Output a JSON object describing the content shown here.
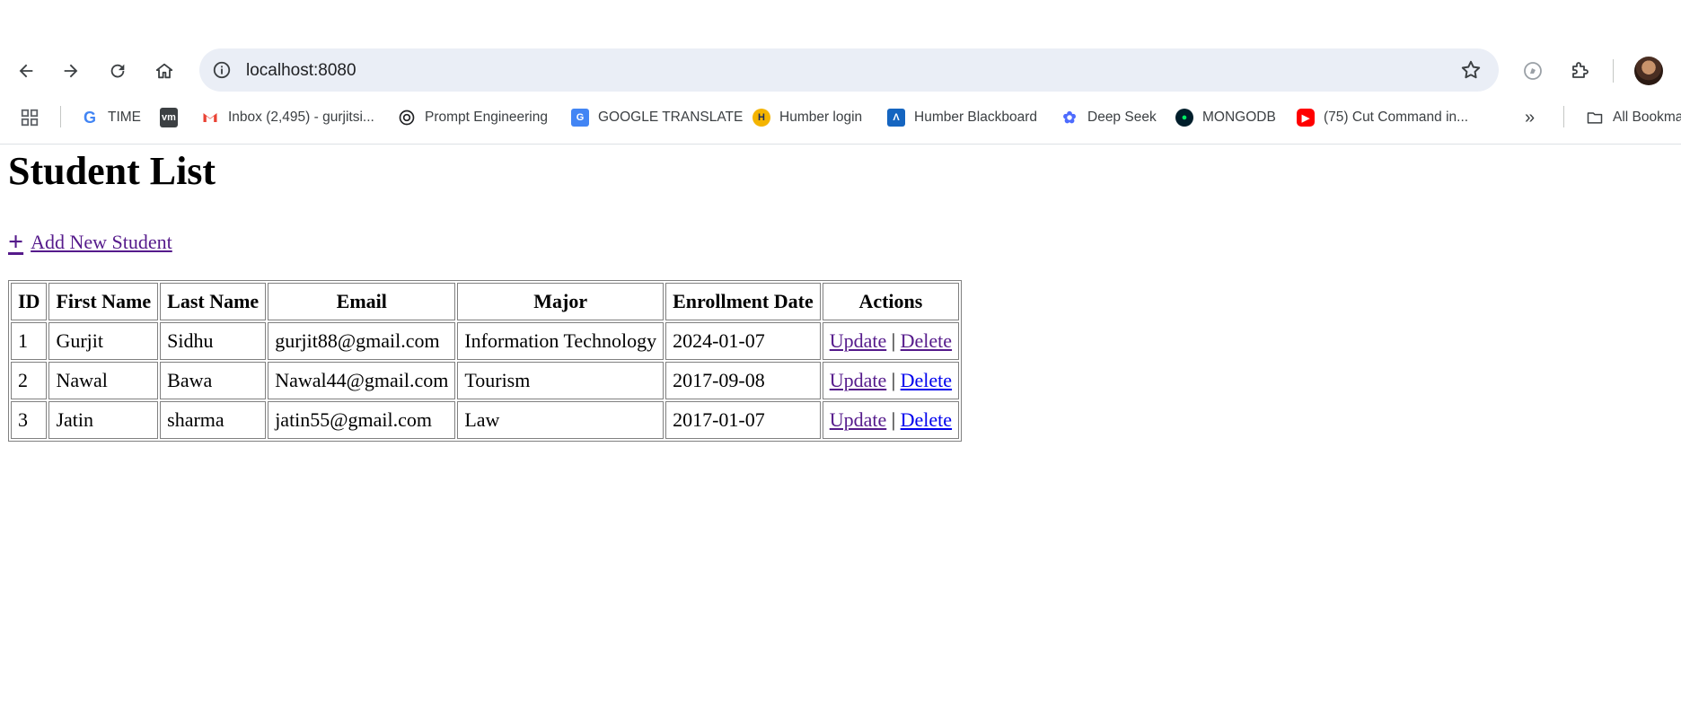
{
  "browser": {
    "url": "localhost:8080",
    "bookmarks": [
      {
        "label": "TIME",
        "icon": "google-icon"
      },
      {
        "label": "",
        "icon": "vm-icon",
        "badge": "vm"
      },
      {
        "label": "Inbox (2,495) - gurjitsi...",
        "icon": "gmail-icon"
      },
      {
        "label": "Prompt Engineering",
        "icon": "openai-icon"
      },
      {
        "label": "GOOGLE TRANSLATE",
        "icon": "translate-icon"
      },
      {
        "label": "Humber login",
        "icon": "humber-icon"
      },
      {
        "label": "Humber Blackboard",
        "icon": "blackboard-icon"
      },
      {
        "label": "Deep Seek",
        "icon": "deepseek-icon"
      },
      {
        "label": "MONGODB",
        "icon": "mongodb-icon"
      },
      {
        "label": "(75) Cut Command in...",
        "icon": "youtube-icon"
      }
    ],
    "all_bookmarks": "All Bookmarks"
  },
  "page": {
    "title": "Student List",
    "add_link": "Add New Student",
    "add_icon": "+",
    "table": {
      "headers": [
        "ID",
        "First Name",
        "Last Name",
        "Email",
        "Major",
        "Enrollment Date",
        "Actions"
      ],
      "rows": [
        {
          "id": "1",
          "first": "Gurjit",
          "last": "Sidhu",
          "email": "gurjit88@gmail.com",
          "major": "Information Technology",
          "date": "2024-01-07",
          "update": "Update",
          "sep": "|",
          "delete": "Delete"
        },
        {
          "id": "2",
          "first": "Nawal",
          "last": "Bawa",
          "email": "Nawal44@gmail.com",
          "major": "Tourism",
          "date": "2017-09-08",
          "update": "Update",
          "sep": "|",
          "delete": "Delete"
        },
        {
          "id": "3",
          "first": "Jatin",
          "last": "sharma",
          "email": "jatin55@gmail.com",
          "major": "Law",
          "date": "2017-01-07",
          "update": "Update",
          "sep": "|",
          "delete": "Delete"
        }
      ]
    }
  },
  "colors": {
    "link_visited": "#551a8b",
    "link_unvisited": "#0000ee",
    "omnibox_bg": "#eaeef6"
  }
}
